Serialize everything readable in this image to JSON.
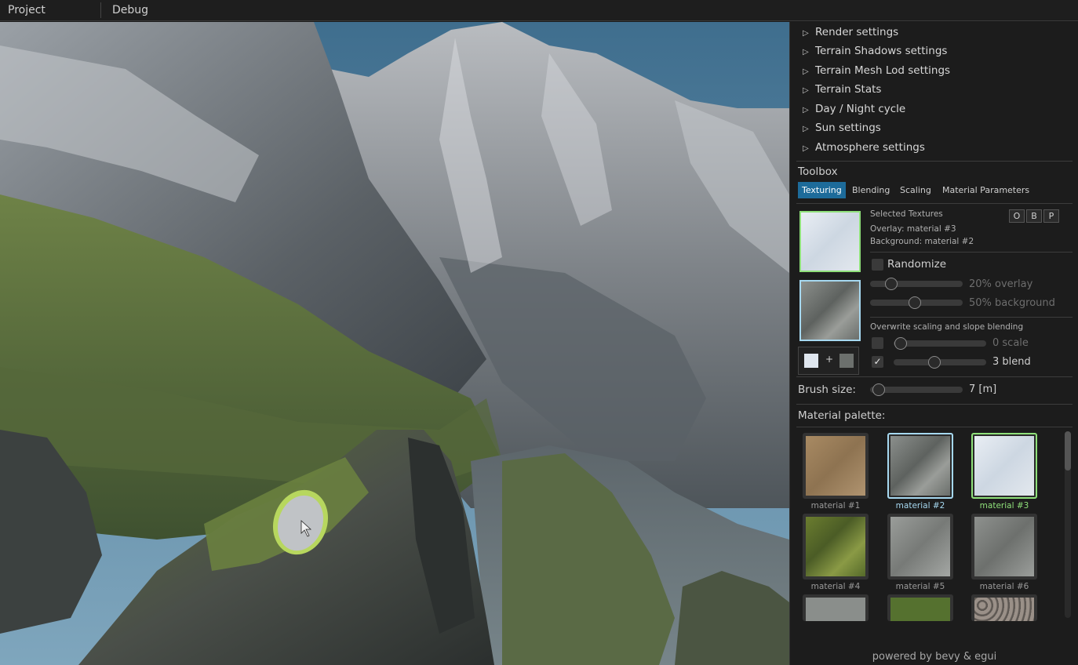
{
  "menu": {
    "project": "Project",
    "debug": "Debug"
  },
  "sections": [
    "Render settings",
    "Terrain Shadows settings",
    "Terrain Mesh Lod settings",
    "Terrain Stats",
    "Day / Night cycle",
    "Sun settings",
    "Atmosphere settings"
  ],
  "toolbox": {
    "title": "Toolbox",
    "tabs": [
      "Texturing",
      "Blending",
      "Scaling",
      "Material Parameters"
    ],
    "active_tab": "Texturing",
    "selected_title": "Selected Textures",
    "overlay": "Overlay: material #3",
    "background": "Background: material #2",
    "mode_buttons": [
      "O",
      "B",
      "P"
    ],
    "randomize_label": "Randomize",
    "overlay_slider": {
      "label": "20% overlay",
      "value": 20
    },
    "background_slider": {
      "label": "50% background",
      "value": 50
    },
    "overwrite_label": "Overwrite scaling and slope blending",
    "scale": {
      "label": "0 scale",
      "value": 0,
      "checked": false
    },
    "blend": {
      "label": "3 blend",
      "value": 3,
      "checked": true
    },
    "combo_plus": "+",
    "brush_label": "Brush size:",
    "brush_value": "7 [m]"
  },
  "palette": {
    "title": "Material palette:",
    "items": [
      {
        "label": "material #1",
        "texture": "sand"
      },
      {
        "label": "material #2",
        "texture": "rock",
        "selected": "background"
      },
      {
        "label": "material #3",
        "texture": "snow",
        "selected": "overlay"
      },
      {
        "label": "material #4",
        "texture": "moss"
      },
      {
        "label": "material #5",
        "texture": "stone"
      },
      {
        "label": "material #6",
        "texture": "stone"
      }
    ]
  },
  "colors": {
    "overlay_highlight": "#8fe07a",
    "background_highlight": "#a6d8f0",
    "tab_active": "#1d6b9a"
  },
  "footer": "powered by bevy & egui"
}
